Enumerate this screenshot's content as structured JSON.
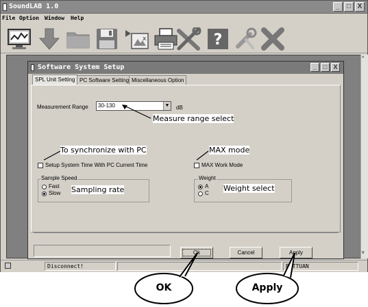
{
  "app": {
    "title": "SoundLAB 1.0",
    "window_buttons": [
      "_",
      "□",
      "X"
    ]
  },
  "menu": {
    "items": [
      "File",
      "Option",
      "Window",
      "Help"
    ]
  },
  "toolbar": {
    "icons": [
      "monitor-graph-icon",
      "download-arrow-icon",
      "folder-icon",
      "save-disk-icon",
      "export-icon",
      "printer-icon",
      "tools-icon",
      "help-icon",
      "wrench-icon",
      "close-x-icon"
    ]
  },
  "statusbar": {
    "connection": "Disconnect!",
    "right": "BOTTUAN"
  },
  "dialog": {
    "title": "Software System Setup",
    "tabs": [
      {
        "label": "SPL Unit Setting",
        "active": true
      },
      {
        "label": "PC Software Setting",
        "active": false
      },
      {
        "label": "Miscellaneous Option",
        "active": false
      }
    ],
    "measurement_range_label": "Measurement Range",
    "measurement_range_value": "30-130",
    "measurement_range_unit": "dB",
    "sync_checkbox_label": "Setup System Time With PC Current Time",
    "sync_checked": false,
    "max_checkbox_label": "MAX Work Mode",
    "max_checked": false,
    "sample_speed": {
      "group_label": "Sample Speed",
      "options": [
        "Fast",
        "Slow"
      ],
      "selected": "Slow"
    },
    "weight": {
      "group_label": "Weight",
      "options": [
        "A",
        "C"
      ],
      "selected": "A"
    },
    "buttons": {
      "ok": "Ok",
      "cancel": "Cancel",
      "apply": "Apply"
    }
  },
  "annotations": {
    "measure_range": "Measure range select",
    "sync": "To synchronize with PC",
    "max": "MAX mode",
    "sampling": "Sampling rate",
    "weight": "Weight select",
    "ok_bubble": "OK",
    "apply_bubble": "Apply"
  }
}
